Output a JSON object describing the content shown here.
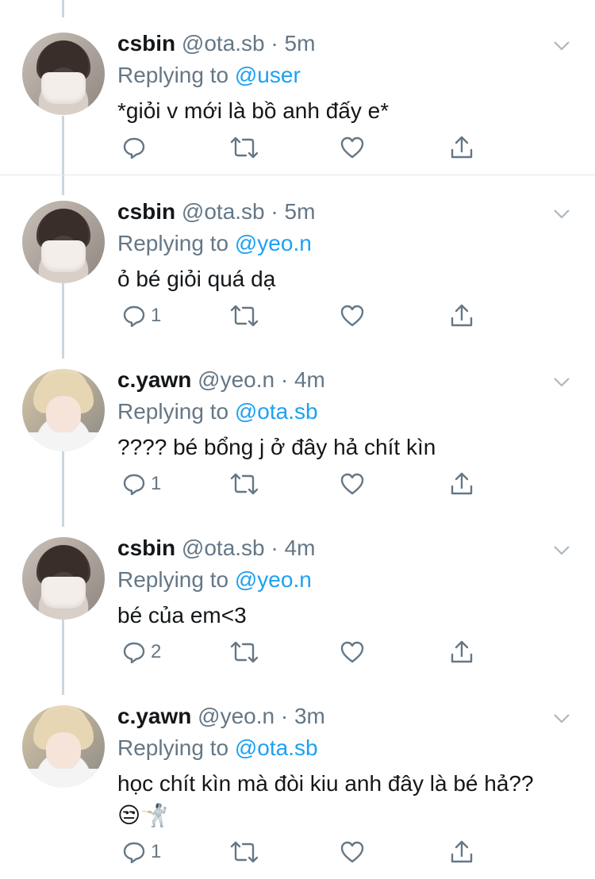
{
  "tweets": [
    {
      "name": "csbin",
      "handle": "@ota.sb",
      "sep": "·",
      "time": "5m",
      "reply_prefix": "Replying to",
      "reply_to": "@user",
      "text": "*giỏi v mới là bồ anh đấy e*",
      "reply_count": ""
    },
    {
      "name": "csbin",
      "handle": "@ota.sb",
      "sep": "·",
      "time": "5m",
      "reply_prefix": "Replying to",
      "reply_to": "@yeo.n",
      "text": "ỏ bé giỏi quá dạ",
      "reply_count": "1"
    },
    {
      "name": "c.yawn",
      "handle": "@yeo.n",
      "sep": "·",
      "time": "4m",
      "reply_prefix": "Replying to",
      "reply_to": "@ota.sb",
      "text": "???? bé bổng j ở đây hả chít kìn",
      "reply_count": "1"
    },
    {
      "name": "csbin",
      "handle": "@ota.sb",
      "sep": "·",
      "time": "4m",
      "reply_prefix": "Replying to",
      "reply_to": "@yeo.n",
      "text": "bé của em<3",
      "reply_count": "2"
    },
    {
      "name": "c.yawn",
      "handle": "@yeo.n",
      "sep": "·",
      "time": "3m",
      "reply_prefix": "Replying to",
      "reply_to": "@ota.sb",
      "text": "học chít kìn mà đòi kiu anh đây là bé hả??😒🤺",
      "reply_count": "1"
    }
  ],
  "icons": [
    "reply-icon",
    "retweet-icon",
    "like-icon",
    "share-icon",
    "chevron-down-icon"
  ],
  "colors": {
    "link": "#1da1f2",
    "muted": "#657786",
    "divider": "#e1e8ed"
  }
}
